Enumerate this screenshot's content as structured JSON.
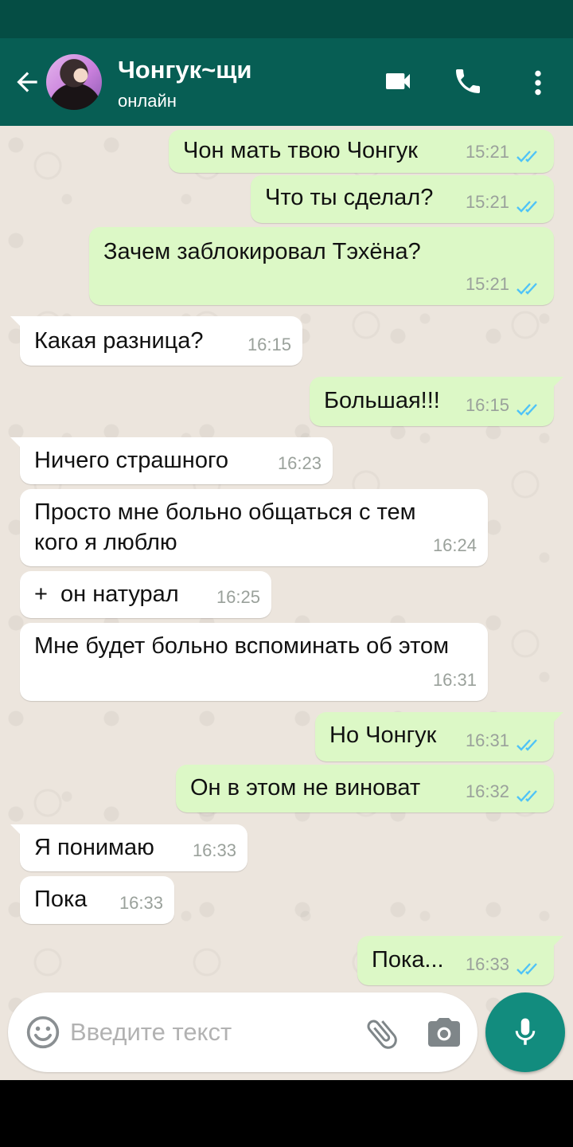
{
  "header": {
    "title": "Чонгук~щи",
    "subtitle": "онлайн"
  },
  "messages": [
    {
      "dir": "out",
      "text": "Чон мать твою Чонгук",
      "time": "15:21",
      "read": true
    },
    {
      "dir": "out",
      "text": "Что ты сделал?",
      "time": "15:21",
      "read": true
    },
    {
      "dir": "out",
      "text": "Зачем заблокировал Тэхёна?",
      "time": "15:21",
      "read": true
    },
    {
      "dir": "in",
      "text": "Какая разница?",
      "time": "16:15"
    },
    {
      "dir": "out",
      "text": "Большая!!!",
      "time": "16:15",
      "read": true
    },
    {
      "dir": "in",
      "text": "Ничего страшного",
      "time": "16:23"
    },
    {
      "dir": "in",
      "text": "Просто мне больно общаться с тем кого я люблю",
      "time": "16:24"
    },
    {
      "dir": "in",
      "text": "+  он натурал",
      "time": "16:25"
    },
    {
      "dir": "in",
      "text": "Мне будет больно вспоминать об этом",
      "time": "16:31"
    },
    {
      "dir": "out",
      "text": "Но Чонгук",
      "time": "16:31",
      "read": true
    },
    {
      "dir": "out",
      "text": "Он в этом не виноват",
      "time": "16:32",
      "read": true
    },
    {
      "dir": "in",
      "text": "Я понимаю",
      "time": "16:33"
    },
    {
      "dir": "in",
      "text": "Пока",
      "time": "16:33"
    },
    {
      "dir": "out",
      "text": "Пока...",
      "time": "16:33",
      "read": true
    }
  ],
  "input": {
    "placeholder": "Введите текст"
  },
  "colors": {
    "header": "#075e54",
    "status_bar": "#054d44",
    "outgoing_bubble": "#dcf8c6",
    "incoming_bubble": "#ffffff",
    "chat_background": "#ece5dd",
    "read_ticks": "#4fc3f7",
    "mic_button": "#128c7e"
  },
  "icons": {
    "back": "arrow-left-icon",
    "video": "video-camera-icon",
    "call": "phone-icon",
    "menu": "more-vertical-icon",
    "emoji": "smiley-icon",
    "attach": "paperclip-icon",
    "camera": "camera-icon",
    "mic": "microphone-icon",
    "read_receipt": "double-check-icon"
  }
}
